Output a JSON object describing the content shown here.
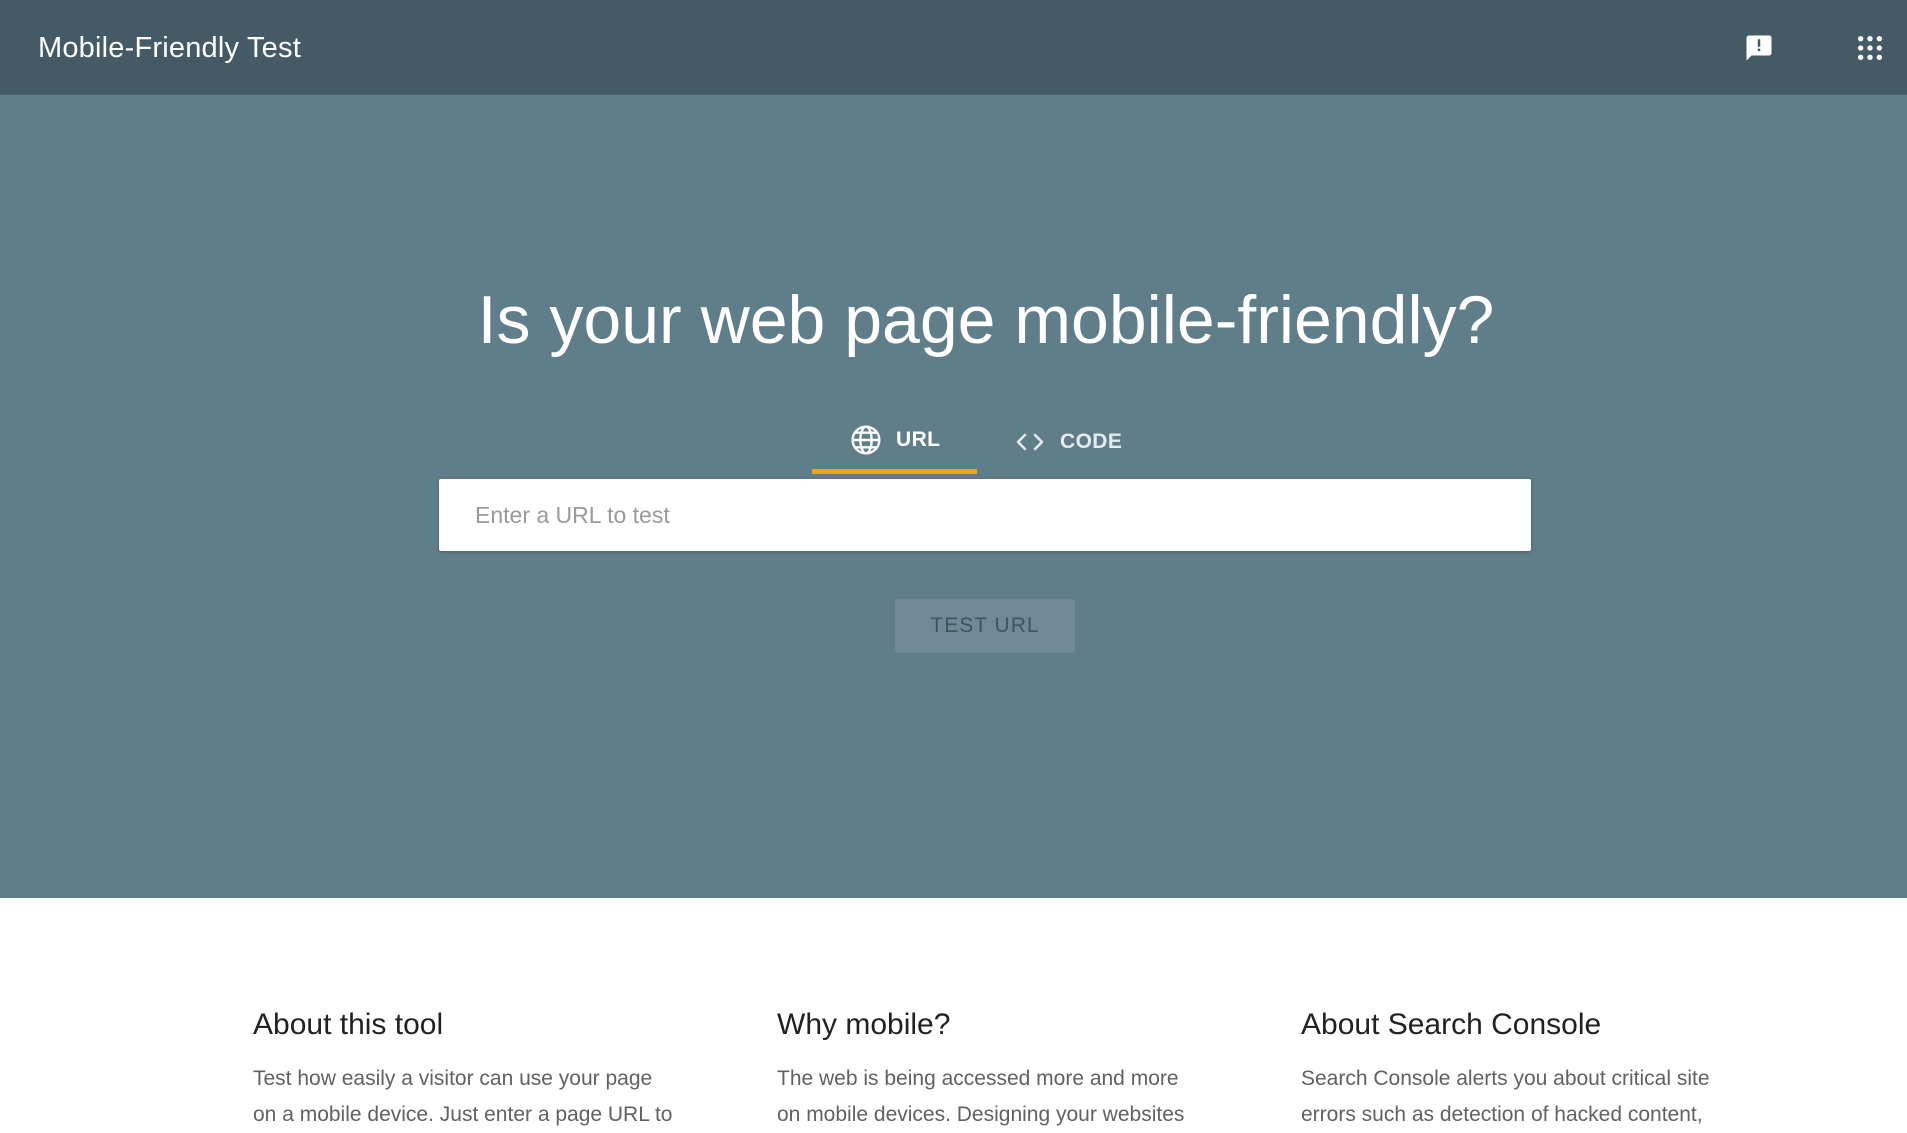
{
  "header": {
    "title": "Mobile-Friendly Test",
    "icons": [
      "feedback-icon",
      "apps-grid-icon"
    ]
  },
  "hero": {
    "title": "Is your web page mobile-friendly?",
    "tabs": [
      {
        "label": "URL",
        "icon": "globe-icon",
        "active": true
      },
      {
        "label": "CODE",
        "icon": "code-brackets-icon",
        "active": false
      }
    ],
    "url_input": {
      "value": "",
      "placeholder": "Enter a URL to test"
    },
    "test_button": {
      "label": "TEST URL",
      "enabled": false
    }
  },
  "info": [
    {
      "heading": "About this tool",
      "text": "Test how easily a visitor can use your page on a mobile device. Just enter a page URL to"
    },
    {
      "heading": "Why mobile?",
      "text": "The web is being accessed more and more on mobile devices. Designing your websites"
    },
    {
      "heading": "About Search Console",
      "text": "Search Console alerts you about critical site errors such as detection of hacked content,"
    }
  ],
  "colors": {
    "header_bg": "#455a67",
    "hero_bg": "#607d8a",
    "tab_indicator": "#f6a300",
    "button_bg": "#6f8996",
    "button_text": "#3f5560"
  }
}
